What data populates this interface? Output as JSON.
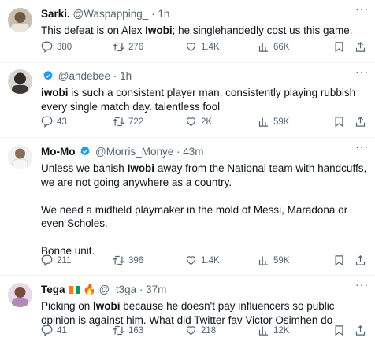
{
  "tweets": [
    {
      "name": "Sarki.",
      "handle": "@Waspapping_",
      "dot": "·",
      "time": "1h",
      "text_parts": [
        "This defeat is on Alex ",
        "Iwobi",
        "; he singlehandedly cost us this game."
      ],
      "replies": "380",
      "retweets": "276",
      "likes": "1.4K",
      "views": "66K"
    },
    {
      "name": "",
      "handle": "@ahdebee",
      "dot": "·",
      "time": "1h",
      "text_parts": [
        "iwobi",
        " is such a consistent player man, consistently playing rubbish every single match day. talentless fool"
      ],
      "replies": "43",
      "retweets": "722",
      "likes": "2K",
      "views": "59K"
    },
    {
      "name": "Mo-Mo",
      "handle": "@Morris_Monye",
      "dot": "·",
      "time": "43m",
      "text_parts": [
        "Unless we banish ",
        "Iwobi",
        " away from the National team with handcuffs, we are not going anywhere as a country.\n\nWe need a midfield playmaker in the mold of Messi, Maradona or even Scholes.\n\nBonne unit."
      ],
      "replies": "211",
      "retweets": "396",
      "likes": "1.4K",
      "views": "59K"
    },
    {
      "name": "Tega",
      "emoji": "🔥",
      "handle": "@_t3ga",
      "dot": "·",
      "time": "37m",
      "text_parts": [
        "Picking on ",
        "Iwobi",
        " because he doesn't pay influencers so public opinion is against him. What did Twitter fav Victor Osimhen do"
      ],
      "replies": "41",
      "retweets": "163",
      "likes": "218",
      "views": "12K"
    }
  ],
  "more_label": "···",
  "colors": {
    "verified": "#1d9bf0",
    "muted": "#536471",
    "flag_orange": "#f77f00",
    "flag_green": "#009e60"
  },
  "icons": [
    "reply-icon",
    "retweet-icon",
    "like-icon",
    "views-icon",
    "bookmark-icon",
    "share-icon",
    "verified-badge-icon",
    "more-icon"
  ]
}
